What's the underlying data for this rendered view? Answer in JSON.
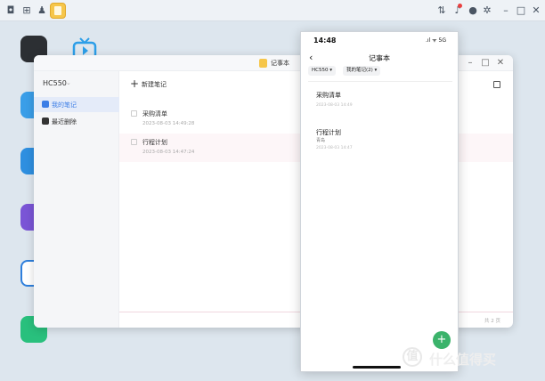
{
  "window": {
    "title": "记事本"
  },
  "sidebar": {
    "device": "HC550",
    "items": [
      {
        "label": "我的笔记"
      },
      {
        "label": "最近删除"
      }
    ]
  },
  "content": {
    "new_note_label": "新建笔记",
    "notes": [
      {
        "title": "采购清单",
        "time": "2023-08-03 14:49:28"
      },
      {
        "title": "行程计划",
        "time": "2023-08-03 14:47:24"
      }
    ],
    "page_info": "共 2 页"
  },
  "phone": {
    "time": "14:48",
    "status": ".ıl ᯤ 5G",
    "title": "记事本",
    "device_pill": "HC550 ▾",
    "folder_pill": "我的笔记(2) ▾",
    "notes": [
      {
        "title": "采购清单",
        "subtitle": "",
        "time": "2023-08-03 14:49"
      },
      {
        "title": "行程计划",
        "subtitle": "青岛",
        "time": "2023-08-03 14:47"
      }
    ],
    "fab_label": "+"
  },
  "watermark": {
    "mark": "值",
    "text": "什么值得买"
  },
  "colors": {
    "accent": "#3bb36b",
    "active_bg": "#e4ebf9",
    "desktop_bg": "#dde6ee"
  }
}
